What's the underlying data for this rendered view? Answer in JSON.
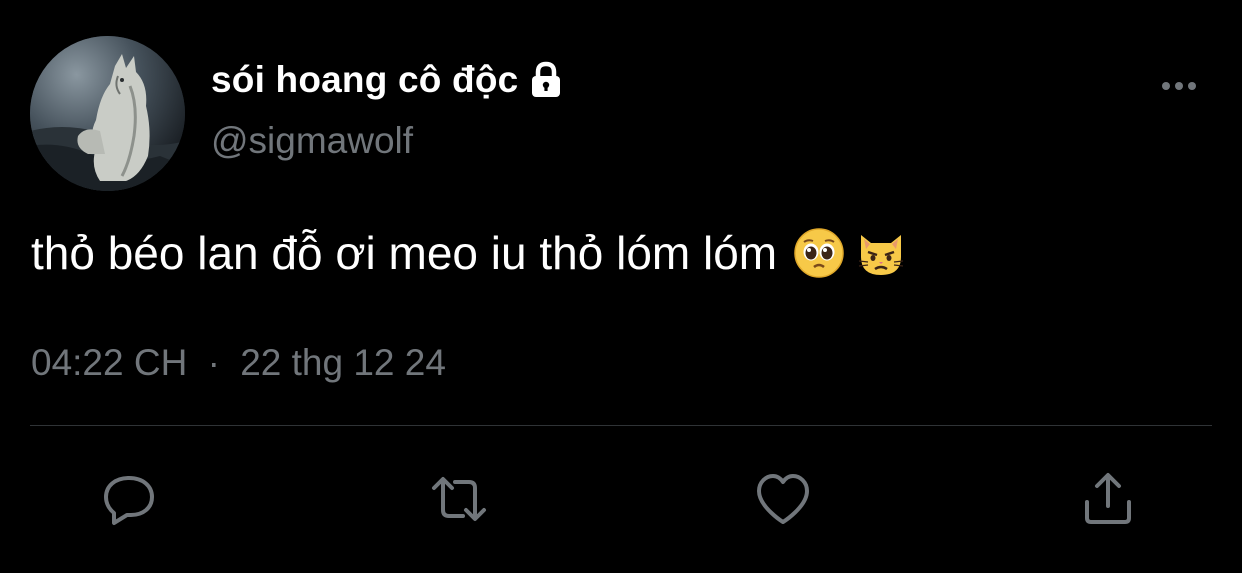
{
  "author": {
    "display_name": "sói hoang cô độc",
    "handle": "@sigmawolf",
    "avatar_icon": "wolf-avatar",
    "protected_icon": "lock-icon"
  },
  "tweet": {
    "text": "thỏ béo lan đỗ ơi meo iu thỏ lóm lóm",
    "emojis": [
      "pleading-face-emoji",
      "pouting-cat-emoji"
    ]
  },
  "meta": {
    "time": "04:22 CH",
    "separator": "·",
    "date": "22 thg 12 24"
  },
  "actions": {
    "reply_icon": "reply-icon",
    "retweet_icon": "retweet-icon",
    "like_icon": "heart-icon",
    "share_icon": "share-icon",
    "more_icon": "more-icon"
  },
  "colors": {
    "background": "#000000",
    "text_primary": "#ffffff",
    "text_secondary": "#71767b",
    "divider": "#2f3336",
    "icon": "#71767b"
  }
}
